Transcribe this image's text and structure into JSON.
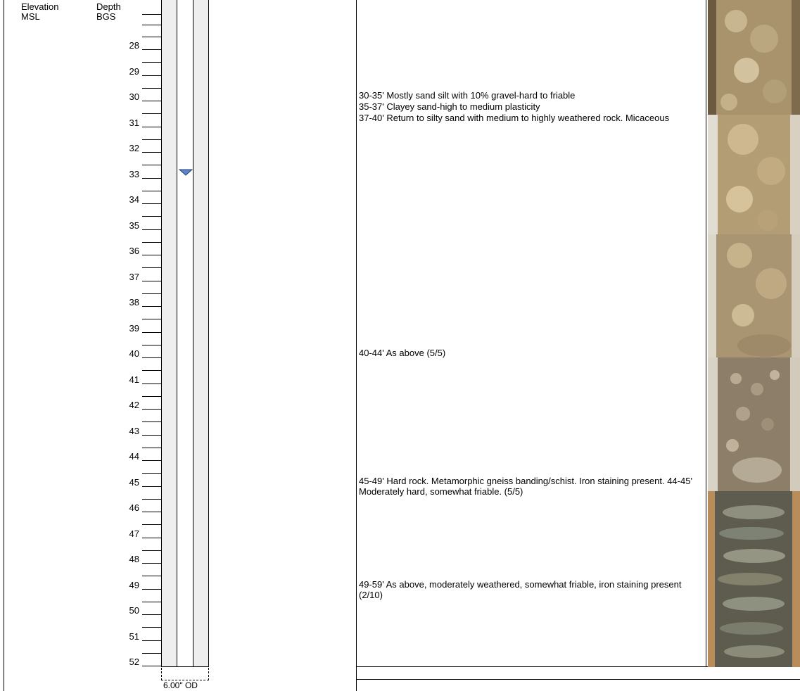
{
  "headers": {
    "elevation_line1": "Elevation",
    "elevation_line2": "MSL",
    "depth_line1": "Depth",
    "depth_line2": "BGS"
  },
  "depth_labels": [
    "28",
    "29",
    "30",
    "31",
    "32",
    "33",
    "34",
    "35",
    "36",
    "37",
    "38",
    "39",
    "40",
    "41",
    "42",
    "43",
    "44",
    "45",
    "46",
    "47",
    "48",
    "49",
    "50",
    "51",
    "52"
  ],
  "well": {
    "casing_label": "6.00\" OD",
    "water_level_marker_depth": "33"
  },
  "descriptions": {
    "d30_35": "30-35' Mostly sand silt with 10% gravel-hard to friable",
    "d35_37": "35-37' Clayey sand-high to medium plasticity",
    "d37_40": "37-40' Return to silty sand with medium to highly weathered rock. Micaceous",
    "d40_44": "40-44' As above (5/5)",
    "d45_49": "45-49' Hard rock. Metamorphic gneiss banding/schist. Iron staining present. 44-45' Moderately hard, somewhat friable. (5/5)",
    "d49_59": "49-59' As above, moderately weathered, somewhat friable, iron staining present (2/10)"
  },
  "photos": [
    {
      "name": "core-photo-soil-1",
      "tone": "#bfae88"
    },
    {
      "name": "core-photo-soil-2",
      "tone": "#c9b38c"
    },
    {
      "name": "core-photo-soil-3",
      "tone": "#b9a47c"
    },
    {
      "name": "core-photo-gravel",
      "tone": "#a59883"
    },
    {
      "name": "core-photo-rock",
      "tone": "#7c7a68"
    }
  ]
}
